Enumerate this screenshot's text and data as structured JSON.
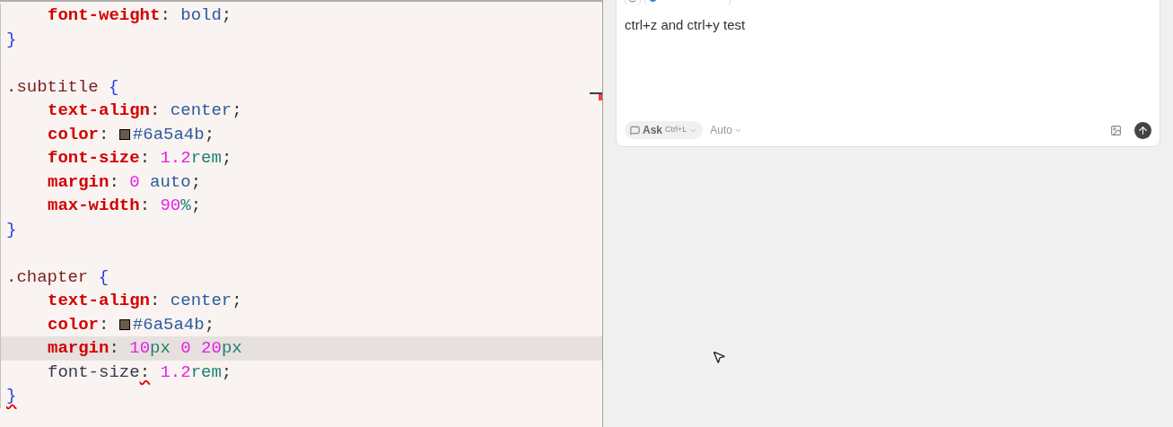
{
  "editor": {
    "lines": [
      {
        "highlighted": false,
        "indented": true,
        "tokens": [
          {
            "kind": "property",
            "text": "font-weight"
          },
          {
            "kind": "punct",
            "text": ": "
          },
          {
            "kind": "value",
            "text": "bold"
          },
          {
            "kind": "punct",
            "text": ";"
          }
        ]
      },
      {
        "highlighted": false,
        "indented": false,
        "tokens": [
          {
            "kind": "brace",
            "text": "}"
          }
        ]
      },
      {
        "highlighted": false
      },
      {
        "highlighted": false,
        "indented": false,
        "tokens": [
          {
            "kind": "selector",
            "text": ".subtitle "
          },
          {
            "kind": "brace",
            "text": "{"
          }
        ]
      },
      {
        "highlighted": false,
        "indented": true,
        "tokens": [
          {
            "kind": "property",
            "text": "text-align"
          },
          {
            "kind": "punct",
            "text": ": "
          },
          {
            "kind": "value",
            "text": "center"
          },
          {
            "kind": "punct",
            "text": ";"
          }
        ]
      },
      {
        "highlighted": false,
        "indented": true,
        "tokens": [
          {
            "kind": "property",
            "text": "color"
          },
          {
            "kind": "punct",
            "text": ": "
          },
          {
            "kind": "swatch",
            "color": "#6a5a4b"
          },
          {
            "kind": "value",
            "text": "#6a5a4b"
          },
          {
            "kind": "punct",
            "text": ";"
          }
        ]
      },
      {
        "highlighted": false,
        "indented": true,
        "tokens": [
          {
            "kind": "property",
            "text": "font-size"
          },
          {
            "kind": "punct",
            "text": ": "
          },
          {
            "kind": "number",
            "text": "1.2"
          },
          {
            "kind": "unit",
            "text": "rem"
          },
          {
            "kind": "punct",
            "text": ";"
          }
        ]
      },
      {
        "highlighted": false,
        "indented": true,
        "tokens": [
          {
            "kind": "property",
            "text": "margin"
          },
          {
            "kind": "punct",
            "text": ": "
          },
          {
            "kind": "number",
            "text": "0"
          },
          {
            "kind": "value",
            "text": " auto"
          },
          {
            "kind": "punct",
            "text": ";"
          }
        ]
      },
      {
        "highlighted": false,
        "indented": true,
        "tokens": [
          {
            "kind": "property",
            "text": "max-width"
          },
          {
            "kind": "punct",
            "text": ": "
          },
          {
            "kind": "number",
            "text": "90"
          },
          {
            "kind": "unit",
            "text": "%"
          },
          {
            "kind": "punct",
            "text": ";"
          }
        ]
      },
      {
        "highlighted": false,
        "indented": false,
        "tokens": [
          {
            "kind": "brace",
            "text": "}"
          }
        ]
      },
      {
        "highlighted": false
      },
      {
        "highlighted": false,
        "indented": false,
        "tokens": [
          {
            "kind": "selector",
            "text": ".chapter "
          },
          {
            "kind": "brace",
            "text": "{"
          }
        ]
      },
      {
        "highlighted": false,
        "indented": true,
        "tokens": [
          {
            "kind": "property",
            "text": "text-align"
          },
          {
            "kind": "punct",
            "text": ": "
          },
          {
            "kind": "value",
            "text": "center"
          },
          {
            "kind": "punct",
            "text": ";"
          }
        ]
      },
      {
        "highlighted": false,
        "indented": true,
        "tokens": [
          {
            "kind": "property",
            "text": "color"
          },
          {
            "kind": "punct",
            "text": ": "
          },
          {
            "kind": "swatch",
            "color": "#6a5a4b"
          },
          {
            "kind": "value",
            "text": "#6a5a4b"
          },
          {
            "kind": "punct",
            "text": ";"
          }
        ]
      },
      {
        "highlighted": true,
        "indented": true,
        "tokens": [
          {
            "kind": "property",
            "text": "margin"
          },
          {
            "kind": "punct",
            "text": ": "
          },
          {
            "kind": "number",
            "text": "10"
          },
          {
            "kind": "unit",
            "text": "px "
          },
          {
            "kind": "number",
            "text": "0 20"
          },
          {
            "kind": "unit",
            "text": "px"
          }
        ]
      },
      {
        "highlighted": false,
        "indented": true,
        "tokens": [
          {
            "kind": "plain",
            "text": "font-size"
          },
          {
            "kind": "punct",
            "text": ":",
            "error": true
          },
          {
            "kind": "number",
            "text": " 1.2"
          },
          {
            "kind": "unit",
            "text": "rem"
          },
          {
            "kind": "punct",
            "text": ";"
          }
        ]
      },
      {
        "highlighted": false,
        "indented": false,
        "tokens": [
          {
            "kind": "brace",
            "text": "}",
            "error": true
          }
        ]
      }
    ]
  },
  "chat": {
    "message": "ctrl+z and ctrl+y test",
    "mode": {
      "label": "Ask",
      "shortcut": "Ctrl+L"
    },
    "model": "Auto"
  }
}
